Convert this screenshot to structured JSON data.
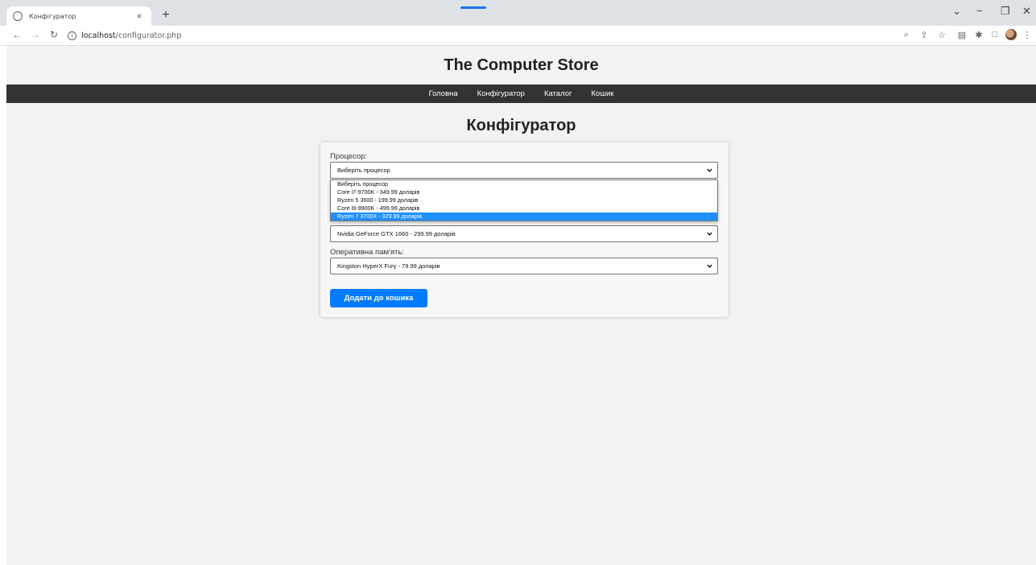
{
  "browser": {
    "tab_title": "Конфігуратор",
    "tab_close": "×",
    "new_tab": "+",
    "url_host": "localhost",
    "url_path": "/configurator.php",
    "icons": [
      "back-icon",
      "forward-icon",
      "reload-icon",
      "info-icon",
      "zoom-icon",
      "share-icon",
      "star-icon",
      "reading-list-icon",
      "extensions-icon",
      "sidebar-icon",
      "profile-icon",
      "menu-icon"
    ]
  },
  "site": {
    "title": "The Computer Store",
    "nav": [
      "Головна",
      "Конфігуратор",
      "Каталог",
      "Кошик"
    ]
  },
  "page": {
    "heading": "Конфігуратор"
  },
  "form": {
    "cpu_label": "Процесор:",
    "cpu_selected": "Виберіть процесор",
    "cpu_options": [
      "Виберіть процесор",
      "Core i7-9700K - 349.99 доларів",
      "Ryzen 5 3600 - 199.99 доларів",
      "Core i9-9900K - 499.99 доларів",
      "Ryzen 7 3700X - 329.99 доларів"
    ],
    "cpu_highlighted_index": 4,
    "gpu_selected": "Nvidia GeForce GTX 1660 - 299.99 доларів",
    "ram_label": "Оперативна пам'ять:",
    "ram_selected": "Kingston HyperX Fury - 79.99 доларів",
    "add_button": "Додати до кошика"
  },
  "colors": {
    "nav_bg": "#333333",
    "page_bg": "#f2f2f2",
    "button": "#007bff",
    "highlight": "#1e90ff"
  }
}
